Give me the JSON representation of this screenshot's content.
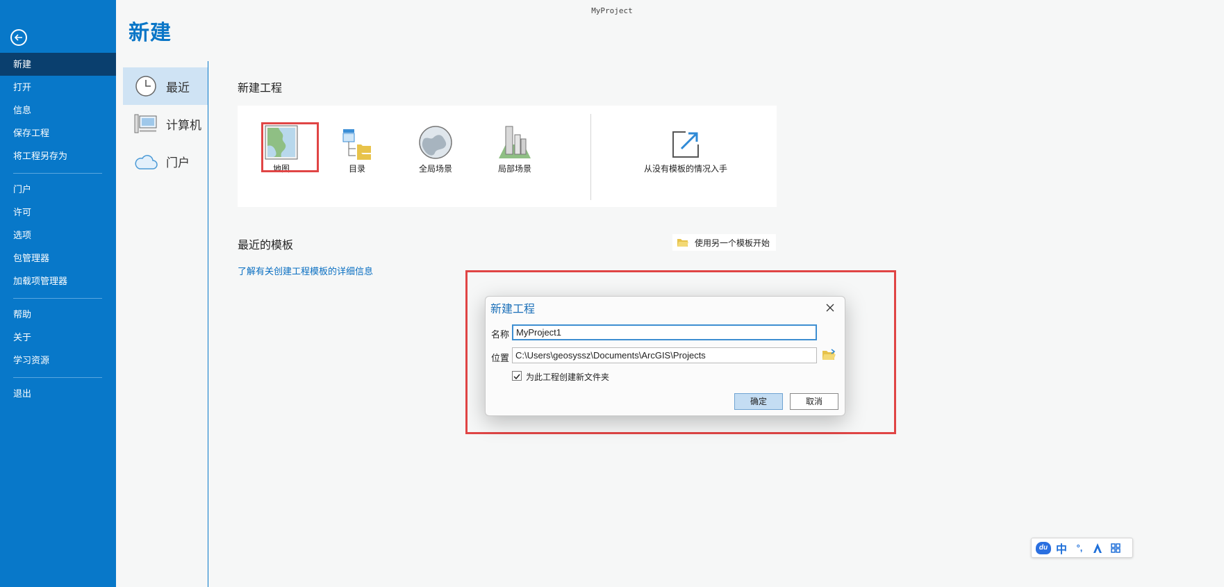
{
  "window": {
    "title": "MyProject"
  },
  "rail": {
    "items": [
      {
        "label": "新建",
        "active": true
      },
      {
        "label": "打开"
      },
      {
        "label": "信息"
      },
      {
        "label": "保存工程"
      },
      {
        "label": "将工程另存为"
      },
      {
        "label": "门户"
      },
      {
        "label": "许可"
      },
      {
        "label": "选项"
      },
      {
        "label": "包管理器"
      },
      {
        "label": "加载项管理器"
      },
      {
        "label": "帮助"
      },
      {
        "label": "关于"
      },
      {
        "label": "学习资源"
      },
      {
        "label": "退出"
      }
    ]
  },
  "page": {
    "heading": "新建"
  },
  "subnav": {
    "items": [
      {
        "label": "最近",
        "icon": "clock-icon",
        "active": true
      },
      {
        "label": "计算机",
        "icon": "computer-icon"
      },
      {
        "label": "门户",
        "icon": "cloud-icon"
      }
    ]
  },
  "new_project": {
    "title": "新建工程",
    "templates": [
      {
        "label": "地图",
        "icon": "map-icon",
        "highlighted": true
      },
      {
        "label": "目录",
        "icon": "catalog-icon"
      },
      {
        "label": "全局场景",
        "icon": "globe-icon"
      },
      {
        "label": "局部场景",
        "icon": "local-scene-icon"
      }
    ],
    "start_without_template": "从没有模板的情况入手"
  },
  "recent_templates": {
    "title": "最近的模板",
    "open_other_label": "使用另一个模板开始",
    "learn_more_link": "了解有关创建工程模板的详细信息"
  },
  "dialog": {
    "title": "新建工程",
    "name_label": "名称",
    "name_value": "MyProject1",
    "location_label": "位置",
    "location_value": "C:\\Users\\geosyssz\\Documents\\ArcGIS\\Projects",
    "create_folder_label": "为此工程创建新文件夹",
    "create_folder_checked": true,
    "ok_label": "确定",
    "cancel_label": "取消"
  },
  "ime": {
    "logo": "du",
    "mode": "中",
    "punct": "°,",
    "items": [
      "ime-logo",
      "chinese-mode",
      "punctuation",
      "skin-icon",
      "toolbox-icon"
    ]
  },
  "colors": {
    "rail": "#0878c9",
    "rail_active": "#0a3f6e",
    "accent": "#0a76c7",
    "highlight": "#e04545"
  }
}
